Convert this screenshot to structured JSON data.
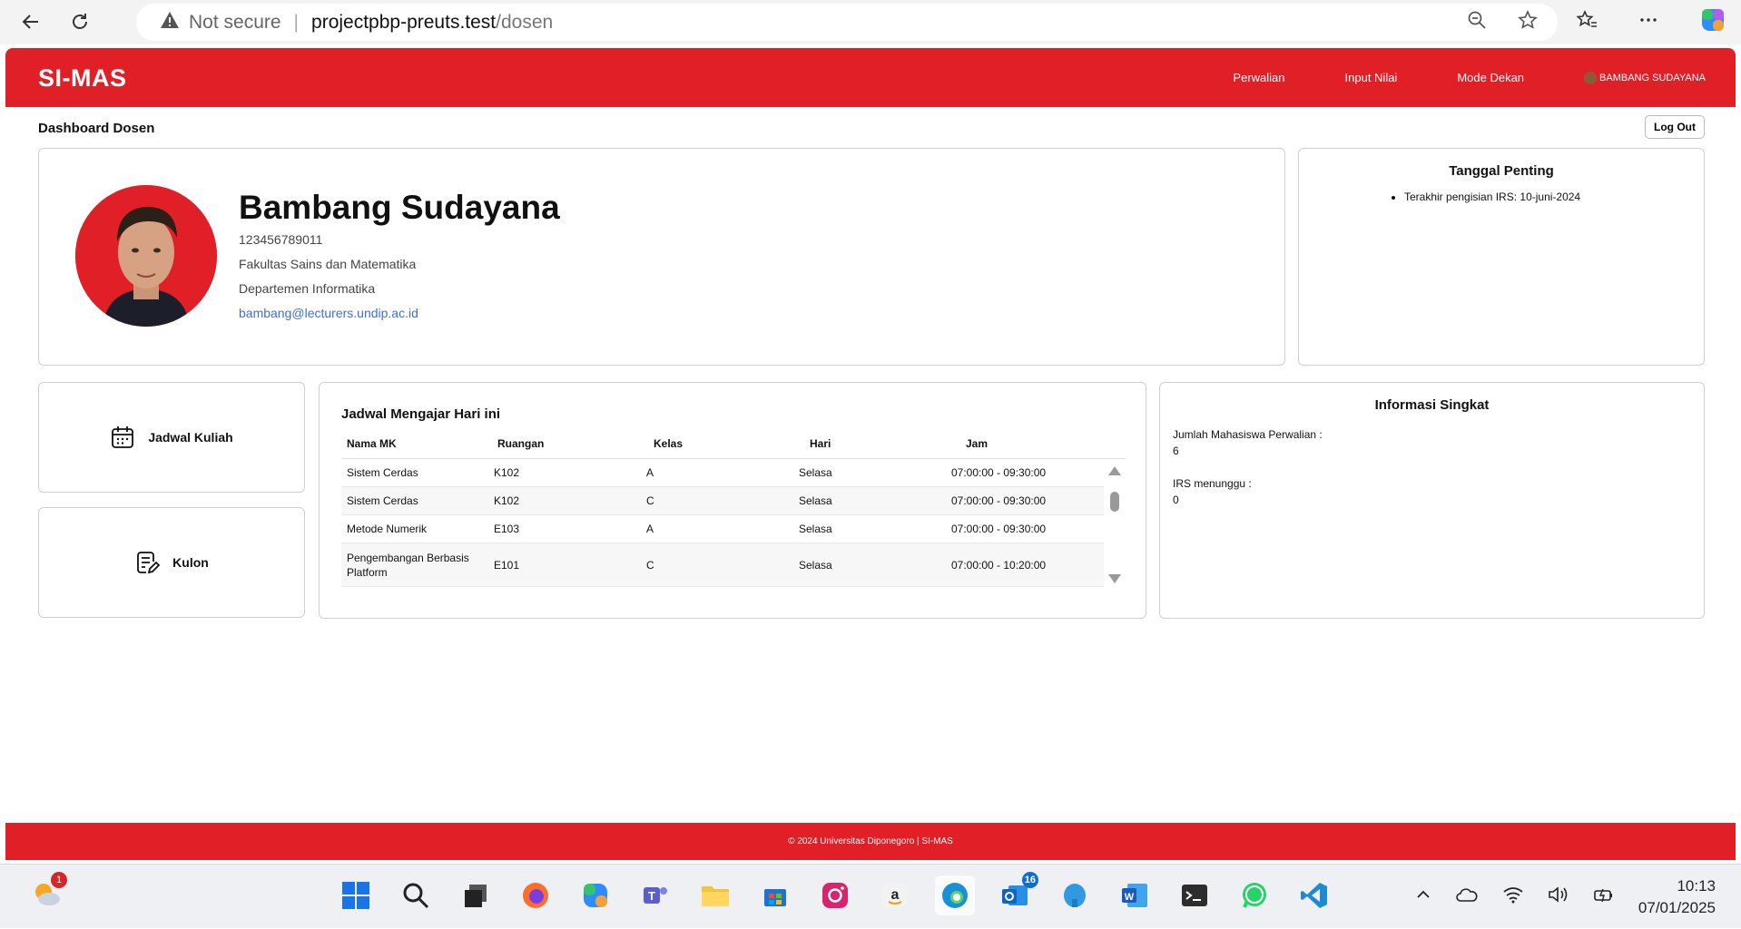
{
  "browser": {
    "security": "Not secure",
    "url_host": "projectpbp-preuts.test",
    "url_path": "/dosen"
  },
  "header": {
    "brand": "SI-MAS",
    "nav": [
      "Perwalian",
      "Input Nilai",
      "Mode Dekan"
    ],
    "user": "BAMBANG SUDAYANA"
  },
  "page": {
    "title": "Dashboard Dosen",
    "logout": "Log Out"
  },
  "profile": {
    "name": "Bambang Sudayana",
    "nip": "123456789011",
    "faculty": "Fakultas Sains dan Matematika",
    "department": "Departemen Informatika",
    "email": "bambang@lecturers.undip.ac.id"
  },
  "tanggal": {
    "title": "Tanggal Penting",
    "items": [
      "Terakhir pengisian IRS: 10-juni-2024"
    ]
  },
  "menu": {
    "jadwal": "Jadwal Kuliah",
    "kulon": "Kulon"
  },
  "jadwal": {
    "title": "Jadwal Mengajar Hari ini",
    "columns": [
      "Nama MK",
      "Ruangan",
      "Kelas",
      "Hari",
      "Jam"
    ],
    "rows": [
      [
        "Sistem Cerdas",
        "K102",
        "A",
        "Selasa",
        "07:00:00 - 09:30:00"
      ],
      [
        "Sistem Cerdas",
        "K102",
        "C",
        "Selasa",
        "07:00:00 - 09:30:00"
      ],
      [
        "Metode Numerik",
        "E103",
        "A",
        "Selasa",
        "07:00:00 - 09:30:00"
      ],
      [
        "Pengembangan Berbasis Platform",
        "E101",
        "C",
        "Selasa",
        "07:00:00 - 10:20:00"
      ]
    ]
  },
  "info": {
    "title": "Informasi Singkat",
    "perwalian_label": "Jumlah Mahasiswa Perwalian :",
    "perwalian_value": "6",
    "irs_label": "IRS menunggu :",
    "irs_value": "0"
  },
  "footer": {
    "text": "© 2024 Universitas Diponegoro | SI-MAS"
  },
  "taskbar": {
    "weather_badge": "1",
    "outlook_badge": "16",
    "time": "10:13",
    "date": "07/01/2025"
  },
  "colors": {
    "brand_red": "#e01f26",
    "link_blue": "#3f6fd6"
  }
}
